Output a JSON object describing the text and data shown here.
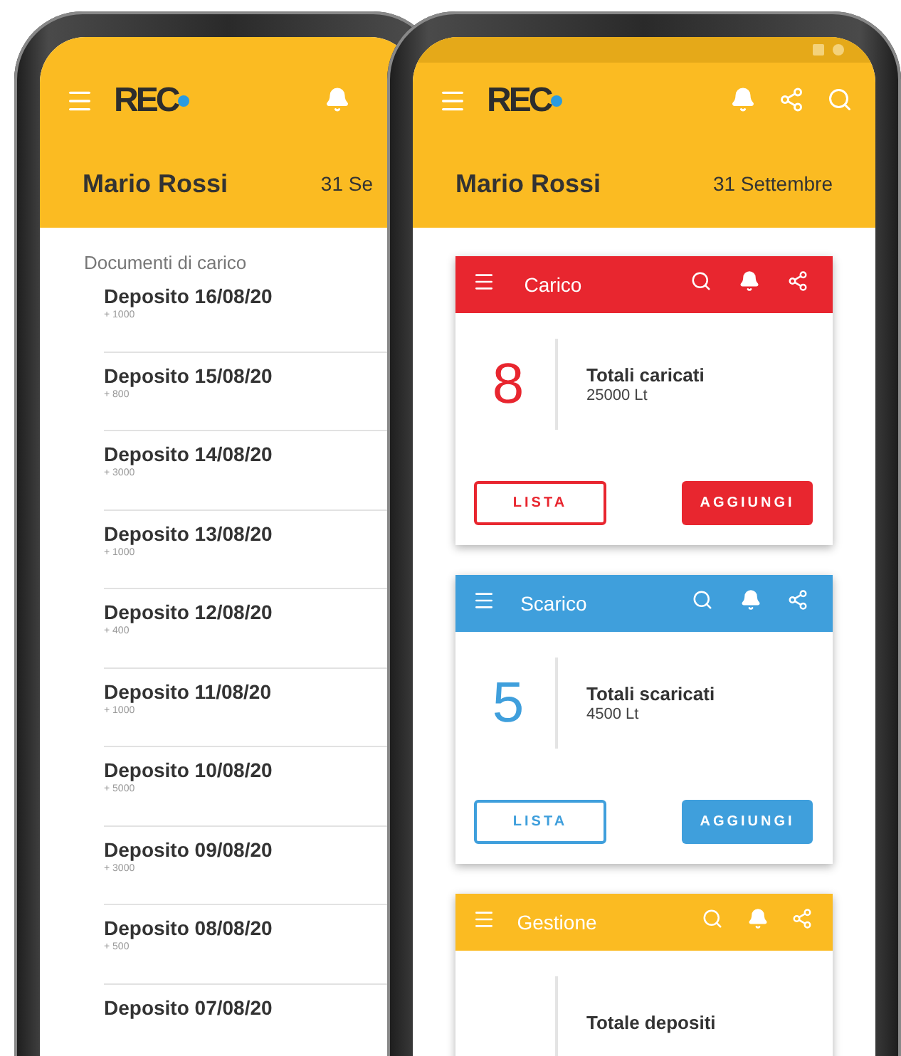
{
  "back_phone": {
    "header": {
      "logo": "REC",
      "user": "Mario Rossi",
      "date": "31 Se"
    },
    "list": {
      "title": "Documenti di carico",
      "items": [
        {
          "title": "Deposito 16/08/20",
          "amount": "+ 1000"
        },
        {
          "title": "Deposito 15/08/20",
          "amount": "+ 800"
        },
        {
          "title": "Deposito 14/08/20",
          "amount": "+ 3000"
        },
        {
          "title": "Deposito 13/08/20",
          "amount": "+ 1000"
        },
        {
          "title": "Deposito 12/08/20",
          "amount": "+ 400"
        },
        {
          "title": "Deposito 11/08/20",
          "amount": "+ 1000"
        },
        {
          "title": "Deposito 10/08/20",
          "amount": "+ 5000"
        },
        {
          "title": "Deposito 09/08/20",
          "amount": "+ 3000"
        },
        {
          "title": "Deposito 08/08/20",
          "amount": "+ 500"
        },
        {
          "title": "Deposito 07/08/20"
        }
      ]
    }
  },
  "front_phone": {
    "header": {
      "logo": "REC",
      "user": "Mario Rossi",
      "date": "31 Settembre"
    },
    "cards": [
      {
        "title": "Carico",
        "color": "#e8262f",
        "count": "8",
        "label": "Totali caricati",
        "amount": "25000 Lt",
        "buttons": [
          {
            "label": "LISTA",
            "kind": "outline"
          },
          {
            "label": "AGGIUNGI",
            "kind": "filled"
          }
        ]
      },
      {
        "title": "Scarico",
        "color": "#3f9fdc",
        "count": "5",
        "label": "Totali scaricati",
        "amount": "4500 Lt",
        "buttons": [
          {
            "label": "LISTA",
            "kind": "outline"
          },
          {
            "label": "AGGIUNGI",
            "kind": "filled"
          }
        ]
      },
      {
        "title": "Gestione",
        "color": "#fbbb22",
        "label": "Totale depositi"
      }
    ]
  }
}
